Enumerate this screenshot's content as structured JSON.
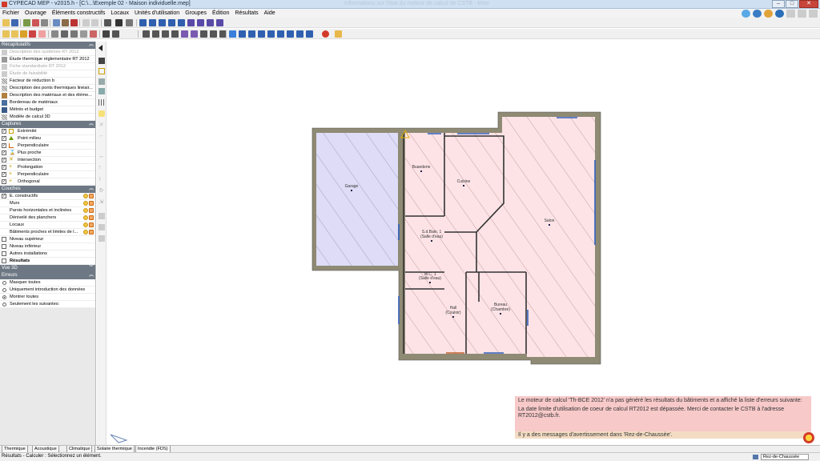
{
  "window": {
    "title": "CYPECAD MEP - v2015.h - [C:\\...\\Exemple 02 - Maison individuelle.mep]",
    "ghost_title": "Informations sur l'état du moteur de calcul de CSTB - Mise"
  },
  "menu": [
    "Fichier",
    "Ouvrage",
    "Éléments constructifs",
    "Locaux",
    "Unités d'utilisation",
    "Groupes",
    "Édition",
    "Résultats",
    "Aide"
  ],
  "panel": {
    "recap": {
      "title": "Récapitulatifs",
      "items": [
        {
          "label": "Description des systèmes RT 2012",
          "grey": true
        },
        {
          "label": "Étude thermique réglementaire RT 2012",
          "grey": false
        },
        {
          "label": "Fiche standardisée RT 2012",
          "grey": true
        },
        {
          "label": "Étude de faisabilité",
          "grey": true
        },
        {
          "label": "Facteur de réduction b",
          "grey": false
        },
        {
          "label": "Description des ponts thermiques linéair...",
          "grey": false
        },
        {
          "label": "Description des matériaux et des éléme...",
          "grey": false
        },
        {
          "label": "Bordereau de matériaux",
          "grey": false
        },
        {
          "label": "Métrés et budget",
          "grey": false
        },
        {
          "label": "Modèle de calcul 3D",
          "grey": false
        }
      ]
    },
    "captures": {
      "title": "Captures",
      "items": [
        "Extrémité",
        "Point milieu",
        "Perpendiculaire",
        "Plus proche",
        "Intersection",
        "Prolongation",
        "Perpendiculaire",
        "Orthogonal"
      ]
    },
    "couches": {
      "title": "Couches",
      "items": [
        {
          "label": "E. constructifs",
          "checked": true,
          "indent": false
        },
        {
          "label": "Murs",
          "checked": false,
          "indent": true
        },
        {
          "label": "Parois horizontales et inclinées",
          "checked": false,
          "indent": true
        },
        {
          "label": "Dénivelé des planchers",
          "checked": false,
          "indent": true
        },
        {
          "label": "Locaux",
          "checked": false,
          "indent": true
        },
        {
          "label": "Bâtiments proches et limites de l...",
          "checked": false,
          "indent": true
        },
        {
          "label": "Niveau supérieur",
          "checked": false,
          "indent": false
        },
        {
          "label": "Niveau inférieur",
          "checked": false,
          "indent": false
        },
        {
          "label": "Autres installations",
          "checked": false,
          "indent": false
        },
        {
          "label": "Résultats",
          "checked": false,
          "indent": false
        }
      ]
    },
    "vue3d": {
      "title": "Vue 3D"
    },
    "erreurs": {
      "title": "Erreurs",
      "options": [
        "Masquer toutes",
        "Uniquement introduction des données",
        "Montrer toutes",
        "Seulement les suivantes:"
      ],
      "selected": 2
    }
  },
  "rooms": {
    "garage": "Garage",
    "buanderie": "Buanderie",
    "cuisine": "Cuisine",
    "salon": "Salon",
    "sdb1": "S.d.Bain. 1",
    "sdb1b": "(Salle d'eau)",
    "wc1": "W.C. 1",
    "wc1b": "(Salle d'eau)",
    "hall": "Hall",
    "hallb": "(Couloir)",
    "bureau": "Bureau",
    "bureaub": "(Chambre)"
  },
  "warning": {
    "line1": "Le moteur de calcul 'Th-BCE 2012' n'a pas généré les résultats du bâtiments et a affiché la liste d'erreurs suivante:",
    "line2": "La date limite d'utilisation de coeur de calcul RT2012 est dépassée. Merci de contacter le CSTB à l'adresse RT2012@cstb.fr.",
    "line3": "Il y a des messages d'avertissement dans 'Rez-de-Chaussée'."
  },
  "tabs": [
    "Thermique",
    "Acoustique",
    "Climatique",
    "Solaire thermique",
    "Incendie (FDS)"
  ],
  "status": {
    "text": "Résultats - Calculer : Sélectionnez un élément.",
    "floor": "Rez-de-Chaussée"
  },
  "colors": {
    "panel_header": "#6d7884",
    "room_pink": "#fde3e6",
    "room_blue": "#dedcf6",
    "wall": "#8f8a74",
    "warning_bg": "#f7c9c9"
  }
}
